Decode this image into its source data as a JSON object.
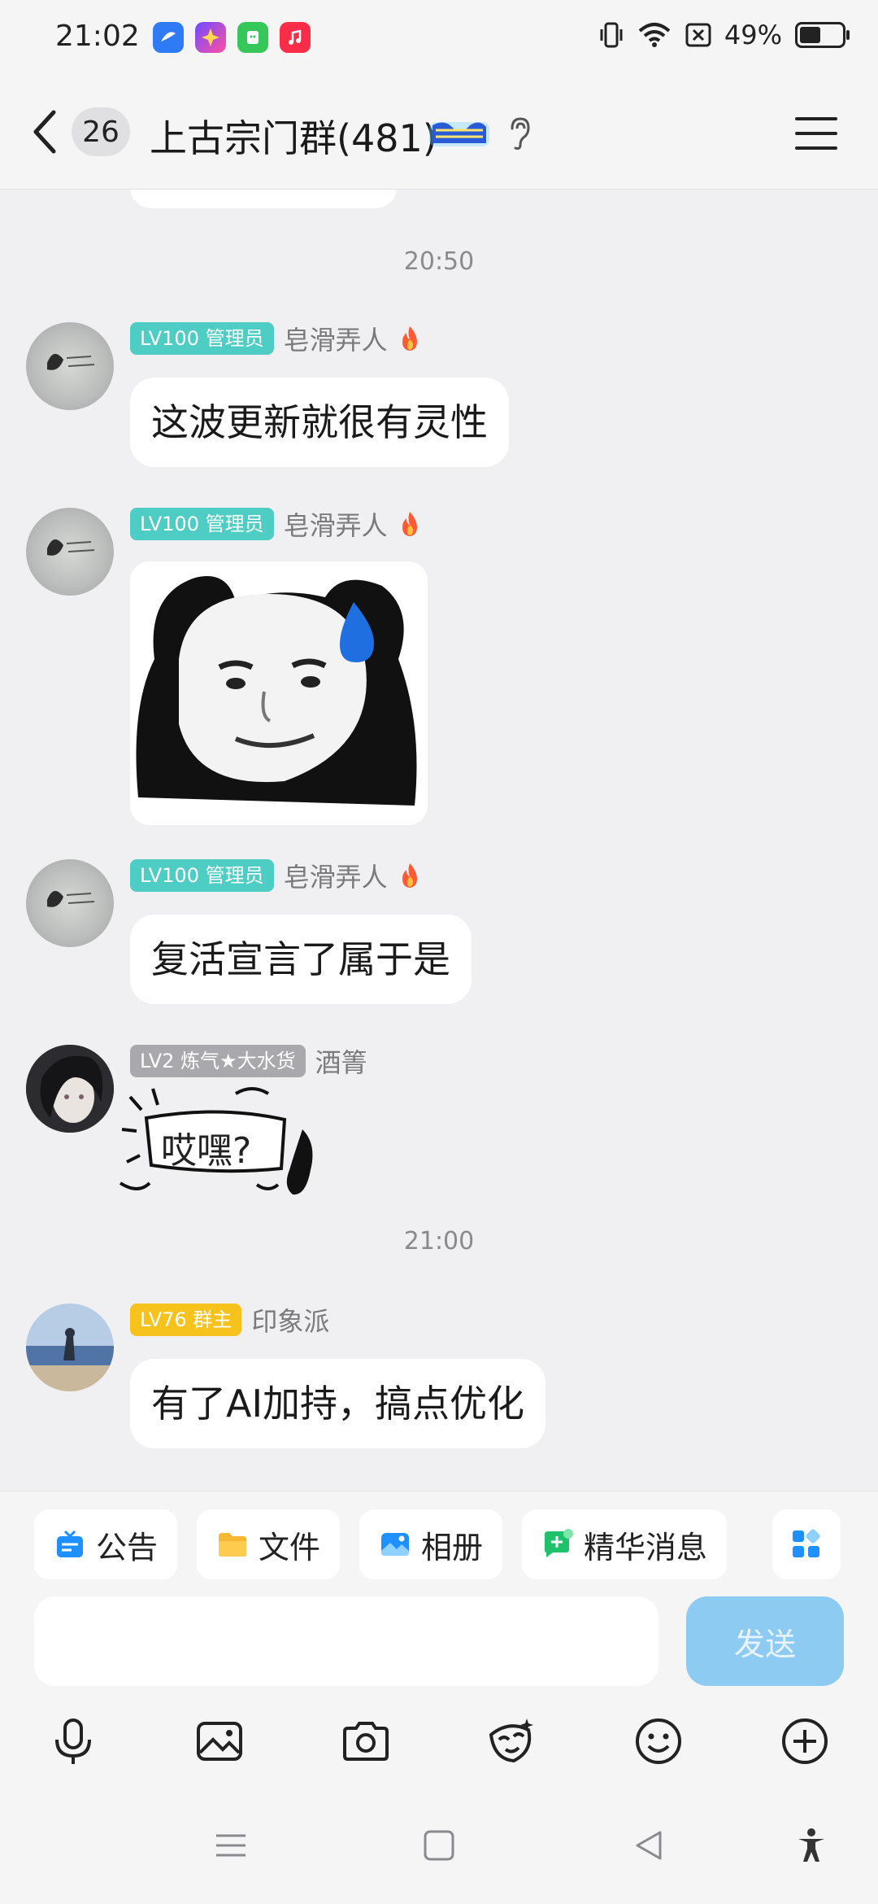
{
  "status_bar": {
    "time": "21:02",
    "battery": "49%",
    "battery_level": 0.49,
    "app_icons": [
      "blue-app-icon",
      "sparkle-app-icon",
      "green-app-icon",
      "music-app-icon"
    ],
    "status_icons": [
      "vibrate-icon",
      "wifi-icon",
      "no-sim-icon",
      "battery-icon"
    ]
  },
  "header": {
    "unread_count": "26",
    "title": "上古宗门群(481)",
    "badge_icon": "group-badge-icon",
    "ear_icon": "ear-icon",
    "menu_icon": "menu-icon"
  },
  "messages": [
    {
      "type": "timestamp",
      "text": "20:50"
    },
    {
      "type": "text",
      "level": "LV100 管理员",
      "sender": "皂滑弄人",
      "text": "这波更新就很有灵性"
    },
    {
      "type": "sticker",
      "level": "LV100 管理员",
      "sender": "皂滑弄人",
      "sticker": "panda-face-sweat-sticker"
    },
    {
      "type": "text",
      "level": "LV100 管理员",
      "sender": "皂滑弄人",
      "text": "复活宣言了属于是"
    },
    {
      "type": "sticker",
      "level": "LV2 炼气★大水货",
      "sender": "酒箐",
      "sticker_text": "哎嘿?"
    },
    {
      "type": "timestamp",
      "text": "21:00"
    },
    {
      "type": "text",
      "level": "LV76 群主",
      "sender": "印象派",
      "text": "有了AI加持，搞点优化"
    }
  ],
  "shortcuts": [
    {
      "label": "公告",
      "icon": "announcement-icon",
      "color": "#1e90ff"
    },
    {
      "label": "文件",
      "icon": "folder-icon",
      "color": "#f7b733"
    },
    {
      "label": "相册",
      "icon": "album-icon",
      "color": "#1e90ff"
    },
    {
      "label": "精华消息",
      "icon": "highlight-message-icon",
      "color": "#1fc16b"
    },
    {
      "label": "",
      "icon": "apps-grid-icon",
      "color": "#1e90ff"
    }
  ],
  "input": {
    "placeholder": "",
    "send_label": "发送"
  },
  "toolbar": [
    "microphone-icon",
    "image-icon",
    "camera-icon",
    "sticker-face-icon",
    "emoji-icon",
    "plus-circle-icon"
  ],
  "nav": [
    "recent-apps-icon",
    "home-icon",
    "back-triangle-icon",
    "accessibility-icon"
  ],
  "colors": {
    "send_button": "#8ecbf3",
    "admin_tag": "#4ecdc4",
    "owner_tag": "#f6c21b",
    "level_tag_grey": "#a9a9ad"
  }
}
